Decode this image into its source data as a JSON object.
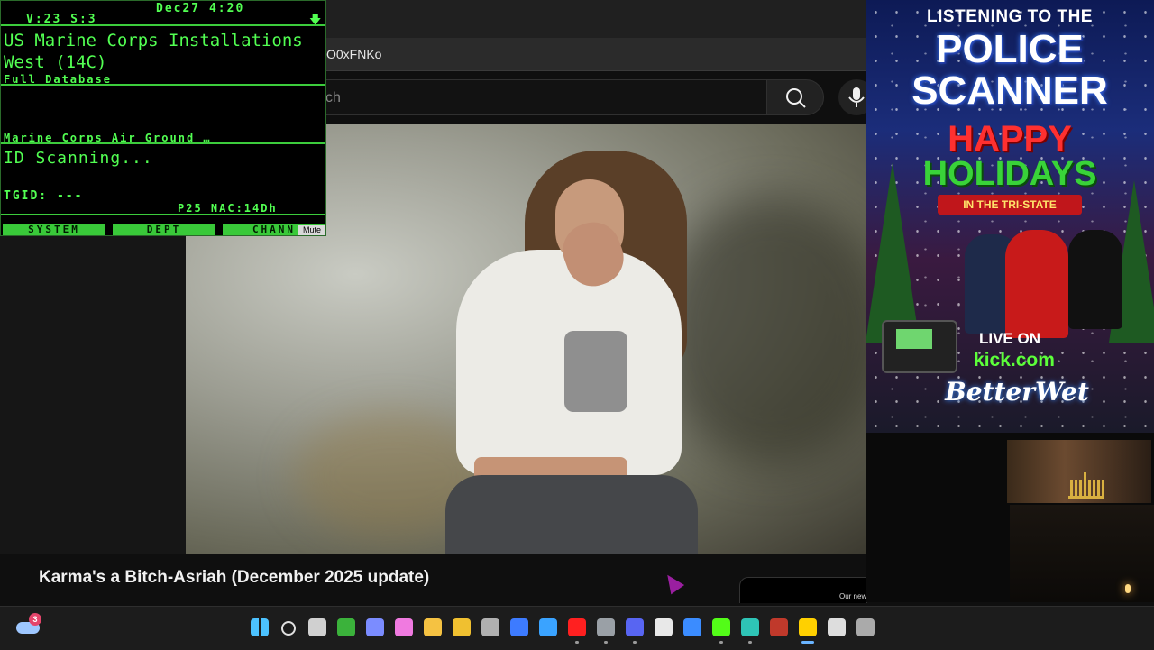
{
  "browser": {
    "address_url": "O0xFNKo",
    "search_placeholder": "ch"
  },
  "video": {
    "title": "Karma's a Bitch-Asriah (December 2025 update)",
    "recommendation_snippet": "Our new"
  },
  "scanner": {
    "datetime": "Dec27  4:20",
    "status": "V:23  S:3",
    "system": "US Marine Corps Installations West (14C)",
    "database": "Full Database",
    "site": "Marine Corps Air Ground …",
    "id_line": "ID Scanning...",
    "tgid": "TGID: ---",
    "nac": "P25 NAC:14Dh",
    "softkeys": [
      "SYSTEM",
      "DEPT",
      "CHANN"
    ],
    "mute_label": "Mute"
  },
  "poster": {
    "line1": "LISTENING TO THE",
    "line2": "POLICE",
    "line3": "SCANNER",
    "line4": "HAPPY",
    "line5": "HOLIDAYS",
    "line6": "IN THE TRI-STATE",
    "live_on": "LIVE ON",
    "site": "kick.com",
    "brand": "BetterWet"
  },
  "taskbar": {
    "weather_badge": "3",
    "icons": [
      {
        "name": "windows-start-icon",
        "color": "#4cc2ff",
        "active": false
      },
      {
        "name": "search-icon",
        "color": "#e0e0e0",
        "active": false
      },
      {
        "name": "task-view-icon",
        "color": "#d0d0d0",
        "active": false
      },
      {
        "name": "xbox-icon",
        "color": "#3bb23b",
        "active": false
      },
      {
        "name": "prism-icon",
        "color": "#7b8cff",
        "active": false
      },
      {
        "name": "copilot-icon",
        "color": "#f07ae0",
        "active": false
      },
      {
        "name": "file-explorer-icon",
        "color": "#f5c242",
        "active": false
      },
      {
        "name": "store-icon",
        "color": "#f0c030",
        "active": false
      },
      {
        "name": "cube-app-icon",
        "color": "#b0b0b0",
        "active": false
      },
      {
        "name": "editor-app-icon",
        "color": "#3d7bff",
        "active": false
      },
      {
        "name": "mail-icon",
        "color": "#3aa3ff",
        "active": false
      },
      {
        "name": "youtube-icon",
        "color": "#ff2020",
        "active": true
      },
      {
        "name": "settings-gear-icon",
        "color": "#9aa0a6",
        "active": true
      },
      {
        "name": "discord-icon",
        "color": "#5865f2",
        "active": true
      },
      {
        "name": "notepad-icon",
        "color": "#e8e8e8",
        "active": false
      },
      {
        "name": "messenger-icon",
        "color": "#3b8cff",
        "active": false
      },
      {
        "name": "kick-icon",
        "color": "#53fc18",
        "active": true
      },
      {
        "name": "edge-browser-icon",
        "color": "#2ec4b6",
        "active": true
      },
      {
        "name": "voicemeeter-icon",
        "color": "#c0392b",
        "active": false
      },
      {
        "name": "scanner-app-icon",
        "color": "#ffd000",
        "active": true
      },
      {
        "name": "obs-icon",
        "color": "#dddddd",
        "active": false
      },
      {
        "name": "chrome-icon",
        "color": "#aaaaaa",
        "active": false
      }
    ]
  }
}
